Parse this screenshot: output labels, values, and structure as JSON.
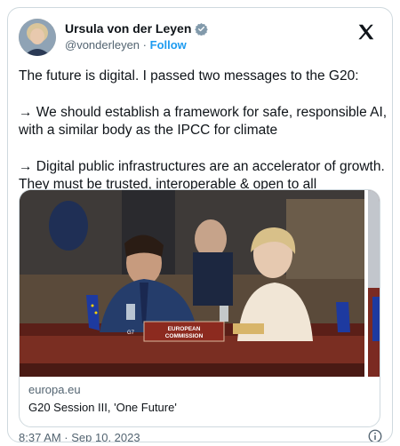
{
  "author": {
    "display_name": "Ursula von der Leyen",
    "handle": "@vonderleyen",
    "separator": "·",
    "follow_label": "Follow"
  },
  "tweet": {
    "paragraphs": [
      "The future is digital. I passed two messages to the G20:",
      "→ We should establish a framework for safe, responsible AI, with a similar body as the IPCC for climate",
      "→ Digital public infrastructures are an accelerator of growth. They must be trusted, interoperable & open to all"
    ]
  },
  "card": {
    "domain": "europa.eu",
    "title": "G20 Session III, 'One Future'",
    "placard_line1": "EUROPEAN",
    "placard_line2": "COMMISSION",
    "table_tag": "G7"
  },
  "meta": {
    "timestamp": "8:37 AM · Sep 10, 2023"
  },
  "colors": {
    "accent": "#1d9bf0",
    "text": "#0f1419",
    "muted": "#536471",
    "border": "#cfd9de"
  },
  "icons": {
    "verified": "verified-badge-icon",
    "brand": "x-logo-icon",
    "info": "info-icon"
  }
}
